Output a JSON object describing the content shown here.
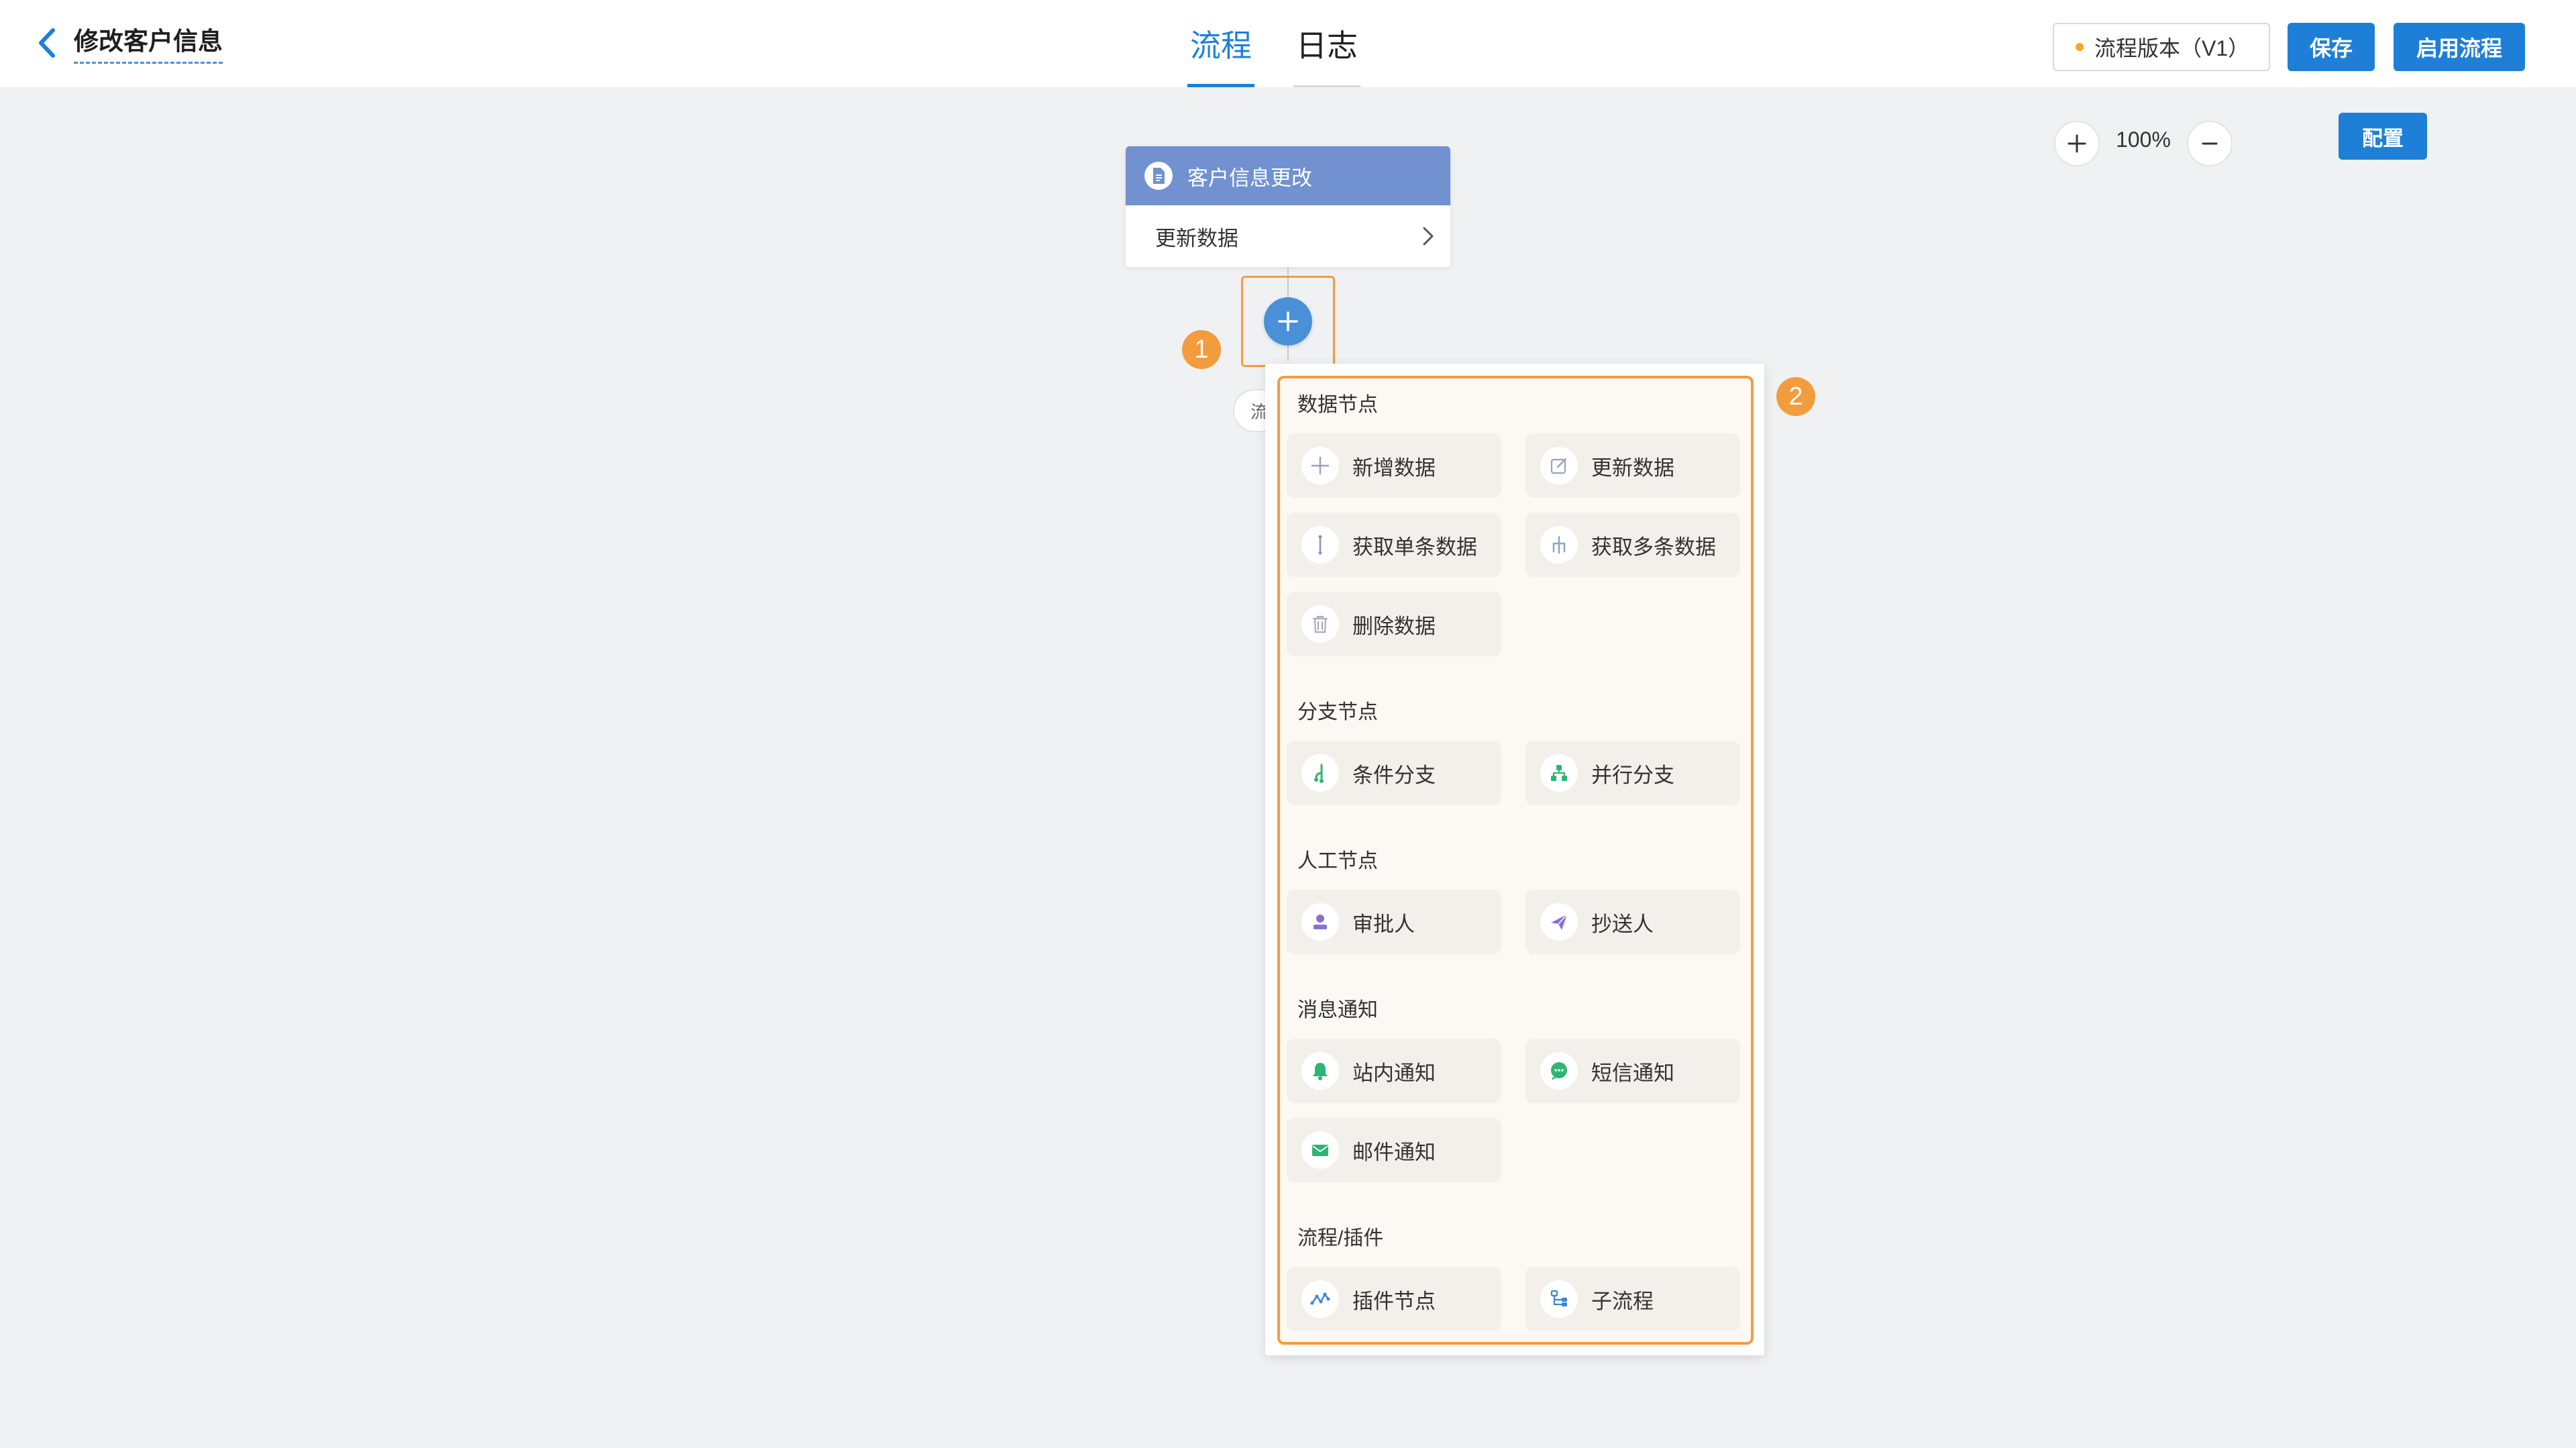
{
  "header": {
    "title": "修改客户信息",
    "tabs": [
      {
        "label": "流程",
        "active": true
      },
      {
        "label": "日志",
        "active": false
      }
    ],
    "version_label": "流程版本（V1）",
    "save_label": "保存",
    "enable_label": "启用流程"
  },
  "toolbar": {
    "zoom_level": "100%",
    "config_label": "配置"
  },
  "node": {
    "header_title": "客户信息更改",
    "body_label": "更新数据"
  },
  "badges": {
    "one": "1",
    "two": "2"
  },
  "hidden_label": "流",
  "popup": {
    "sections": [
      {
        "title": "数据节点",
        "items": [
          {
            "label": "新增数据",
            "icon": "plus-icon"
          },
          {
            "label": "更新数据",
            "icon": "edit-icon"
          },
          {
            "label": "获取单条数据",
            "icon": "single-data-icon"
          },
          {
            "label": "获取多条数据",
            "icon": "multi-data-icon"
          },
          {
            "label": "删除数据",
            "icon": "trash-icon"
          }
        ]
      },
      {
        "title": "分支节点",
        "items": [
          {
            "label": "条件分支",
            "icon": "condition-branch-icon"
          },
          {
            "label": "并行分支",
            "icon": "parallel-branch-icon"
          }
        ]
      },
      {
        "title": "人工节点",
        "items": [
          {
            "label": "审批人",
            "icon": "approver-icon"
          },
          {
            "label": "抄送人",
            "icon": "cc-send-icon"
          }
        ]
      },
      {
        "title": "消息通知",
        "items": [
          {
            "label": "站内通知",
            "icon": "bell-icon"
          },
          {
            "label": "短信通知",
            "icon": "sms-icon"
          },
          {
            "label": "邮件通知",
            "icon": "mail-icon"
          }
        ]
      },
      {
        "title": "流程/插件",
        "items": [
          {
            "label": "插件节点",
            "icon": "plugin-icon"
          },
          {
            "label": "子流程",
            "icon": "subflow-icon"
          }
        ]
      }
    ]
  },
  "colors": {
    "primary": "#1e7fd6",
    "node_header": "#7191d0",
    "highlight": "#f39c3d",
    "green": "#2bb673",
    "purple": "#8e6fd0"
  }
}
